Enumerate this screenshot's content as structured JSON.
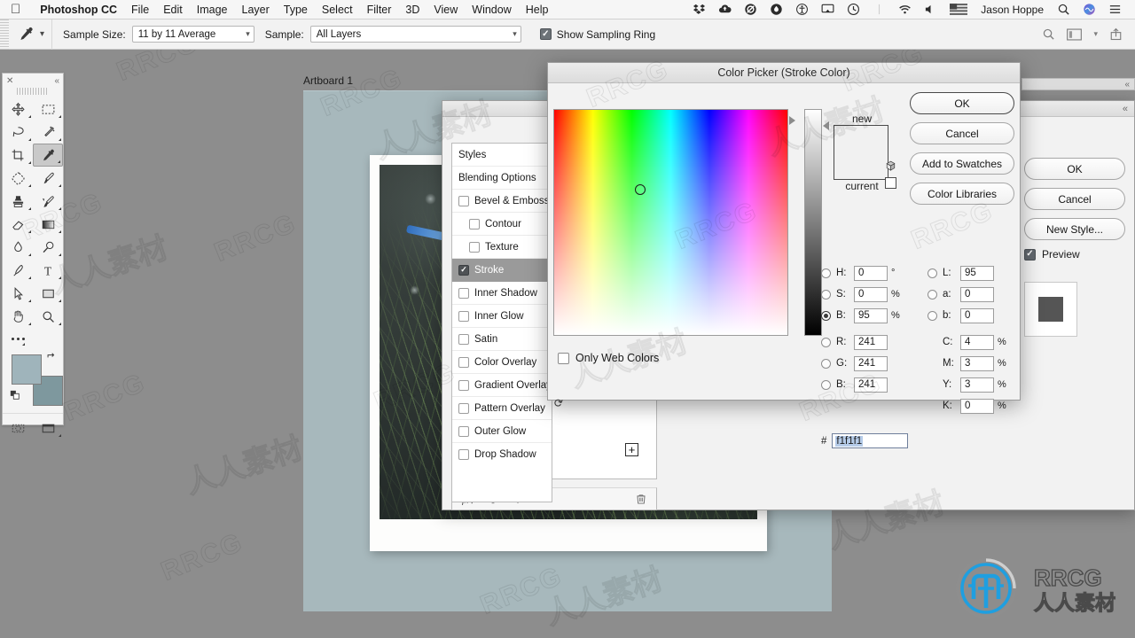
{
  "menubar": {
    "apple_icon": "apple-logo-icon",
    "app_name": "Photoshop CC",
    "items": [
      "File",
      "Edit",
      "Image",
      "Layer",
      "Type",
      "Select",
      "Filter",
      "3D",
      "View",
      "Window",
      "Help"
    ],
    "status_icons": [
      "dropbox-icon",
      "cloud-upload-icon",
      "adblock-icon",
      "flame-icon",
      "accessibility-icon",
      "airplay-icon",
      "time-machine-icon",
      "wifi-icon",
      "volume-icon",
      "us-flag-icon"
    ],
    "user_name": "Jason Hoppe",
    "trailing_icons": [
      "search-icon",
      "siri-icon",
      "notification-center-icon"
    ]
  },
  "options_bar": {
    "tool_icon": "eyedropper-icon",
    "tool_dropdown_caret": "chevron-down-icon",
    "sample_size_label": "Sample Size:",
    "sample_size_value": "11 by 11 Average",
    "sample_label": "Sample:",
    "sample_value": "All Layers",
    "show_sampling_ring_label": "Show Sampling Ring",
    "show_sampling_ring_checked": true,
    "right_icons": [
      "search-icon",
      "workspace-icon",
      "chevron-down-icon",
      "share-icon"
    ]
  },
  "toolbar": {
    "close_icon": "close-icon",
    "collapse_icon": "double-chevron-left-icon",
    "tools": [
      {
        "name": "move-tool",
        "icon": "move-icon"
      },
      {
        "name": "rectangular-marquee-tool",
        "icon": "marquee-icon"
      },
      {
        "name": "lasso-tool",
        "icon": "lasso-icon"
      },
      {
        "name": "quick-selection-tool",
        "icon": "magic-wand-icon"
      },
      {
        "name": "crop-tool",
        "icon": "crop-icon"
      },
      {
        "name": "eyedropper-tool",
        "icon": "eyedropper-icon",
        "active": true
      },
      {
        "name": "healing-brush-tool",
        "icon": "patch-icon"
      },
      {
        "name": "brush-tool",
        "icon": "brush-icon"
      },
      {
        "name": "clone-stamp-tool",
        "icon": "stamp-icon"
      },
      {
        "name": "history-brush-tool",
        "icon": "history-brush-icon"
      },
      {
        "name": "eraser-tool",
        "icon": "eraser-icon"
      },
      {
        "name": "gradient-tool",
        "icon": "gradient-icon"
      },
      {
        "name": "blur-tool",
        "icon": "waterdrop-icon"
      },
      {
        "name": "dodge-tool",
        "icon": "dodge-icon"
      },
      {
        "name": "pen-tool",
        "icon": "pen-icon"
      },
      {
        "name": "type-tool",
        "icon": "text-t-icon"
      },
      {
        "name": "path-selection-tool",
        "icon": "arrow-cursor-icon"
      },
      {
        "name": "rectangle-shape-tool",
        "icon": "rectangle-icon"
      },
      {
        "name": "hand-tool",
        "icon": "hand-icon"
      },
      {
        "name": "zoom-tool",
        "icon": "magnifier-icon"
      }
    ],
    "more_tools_icon": "ellipsis-icon",
    "foreground_color": "#9fb4bb",
    "background_color": "#7e989e",
    "swap_colors_icon": "swap-arrows-icon",
    "default_colors_icon": "default-colors-icon",
    "quick_mask_icon": "quick-mask-icon",
    "screen_mode_icon": "screen-mode-icon"
  },
  "document": {
    "artboard_label": "Artboard 1",
    "canvas_background": "#a7b8bc",
    "photo_frame_color": "#fdfdfc",
    "photo_description": "dark photo of pine needles with snow"
  },
  "layer_style_dialog": {
    "collapse_icon": "double-chevron-left-icon",
    "effects": [
      {
        "label": "Styles",
        "type": "plain"
      },
      {
        "label": "Blending Options",
        "type": "plain"
      },
      {
        "label": "Bevel & Emboss",
        "type": "check",
        "checked": false
      },
      {
        "label": "Contour",
        "type": "check",
        "checked": false,
        "sub": true
      },
      {
        "label": "Texture",
        "type": "check",
        "checked": false,
        "sub": true
      },
      {
        "label": "Stroke",
        "type": "check",
        "checked": true,
        "selected": true
      },
      {
        "label": "Inner Shadow",
        "type": "check",
        "checked": false
      },
      {
        "label": "Inner Glow",
        "type": "check",
        "checked": false
      },
      {
        "label": "Satin",
        "type": "check",
        "checked": false
      },
      {
        "label": "Color Overlay",
        "type": "check",
        "checked": false
      },
      {
        "label": "Gradient Overlay",
        "type": "check",
        "checked": false
      },
      {
        "label": "Pattern Overlay",
        "type": "check",
        "checked": false
      },
      {
        "label": "Outer Glow",
        "type": "check",
        "checked": false
      },
      {
        "label": "Drop Shadow",
        "type": "check",
        "checked": false
      }
    ],
    "add_effect_icon": "plus-box-icon",
    "footer_icons": [
      "fx-icon",
      "move-up-arrow-icon",
      "move-down-arrow-icon",
      "trash-icon"
    ],
    "ok_label": "OK",
    "cancel_label": "Cancel",
    "new_style_label": "New Style...",
    "preview_label": "Preview",
    "preview_checked": true,
    "preview_swatch_color": "#555555"
  },
  "color_picker": {
    "title": "Color Picker (Stroke Color)",
    "ok_label": "OK",
    "cancel_label": "Cancel",
    "add_to_swatches_label": "Add to Swatches",
    "color_libraries_label": "Color Libraries",
    "new_label": "new",
    "current_label": "current",
    "new_swatch_color": "#f1f1f1",
    "only_web_colors_label": "Only Web Colors",
    "only_web_colors_checked": false,
    "out_of_gamut_icon": "gamut-warning-cube-icon",
    "non_web_safe_icon": "non-web-safe-swatch-icon",
    "selected_mode": "B",
    "fields": {
      "H": {
        "label": "H:",
        "value": "0",
        "unit": "°",
        "radio": true,
        "selected": false
      },
      "S": {
        "label": "S:",
        "value": "0",
        "unit": "%",
        "radio": true,
        "selected": false
      },
      "B": {
        "label": "B:",
        "value": "95",
        "unit": "%",
        "radio": true,
        "selected": true
      },
      "R": {
        "label": "R:",
        "value": "241",
        "unit": "",
        "radio": true,
        "selected": false
      },
      "G": {
        "label": "G:",
        "value": "241",
        "unit": "",
        "radio": true,
        "selected": false
      },
      "B2": {
        "label": "B:",
        "value": "241",
        "unit": "",
        "radio": true,
        "selected": false
      },
      "L": {
        "label": "L:",
        "value": "95",
        "unit": "",
        "radio": true,
        "selected": false
      },
      "a": {
        "label": "a:",
        "value": "0",
        "unit": "",
        "radio": true,
        "selected": false
      },
      "b": {
        "label": "b:",
        "value": "0",
        "unit": "",
        "radio": true,
        "selected": false
      },
      "C": {
        "label": "C:",
        "value": "4",
        "unit": "%",
        "radio": false
      },
      "M": {
        "label": "M:",
        "value": "3",
        "unit": "%",
        "radio": false
      },
      "Y": {
        "label": "Y:",
        "value": "3",
        "unit": "%",
        "radio": false
      },
      "K": {
        "label": "K:",
        "value": "0",
        "unit": "%",
        "radio": false
      }
    },
    "hex_prefix": "#",
    "hex_value": "f1f1f1"
  },
  "watermarks": {
    "brand": "RRCG",
    "chinese": "人人素材",
    "logo_brand": "RRCG",
    "logo_sub": "人人素材"
  }
}
